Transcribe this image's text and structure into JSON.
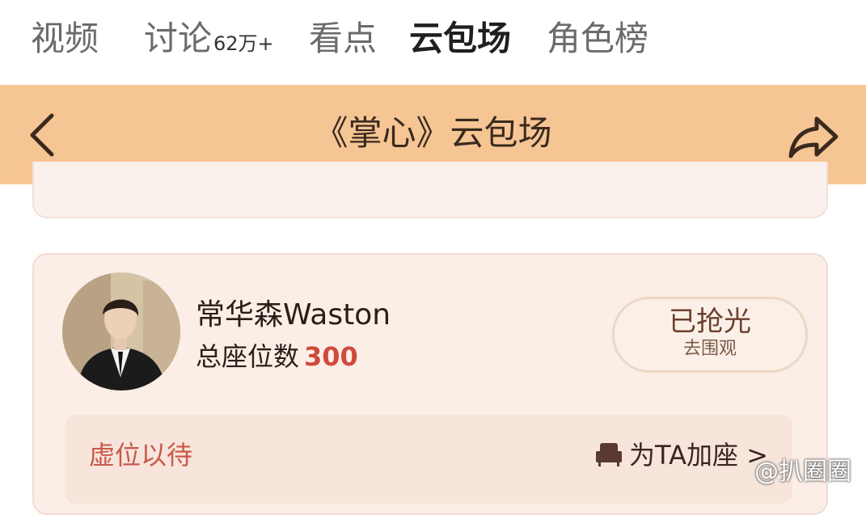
{
  "tabs": [
    {
      "label": "视频"
    },
    {
      "label": "讨论",
      "count": "62万+"
    },
    {
      "label": "看点"
    },
    {
      "label": "云包场",
      "active": true
    },
    {
      "label": "角色榜"
    }
  ],
  "header": {
    "title": "《掌心》云包场",
    "back_icon": "chevron-left-icon",
    "share_icon": "share-arrow-icon",
    "background": "#f6c594"
  },
  "card": {
    "name": "常华森Waston",
    "seats_label": "总座位数",
    "seats_count": "300",
    "status_main": "已抢光",
    "status_sub": "去围观",
    "inner_left": "虚位以待",
    "inner_right": "为TA加座",
    "inner_icon": "seat-icon",
    "accent": "#d0493d"
  },
  "watermark": "@扒圈圈"
}
